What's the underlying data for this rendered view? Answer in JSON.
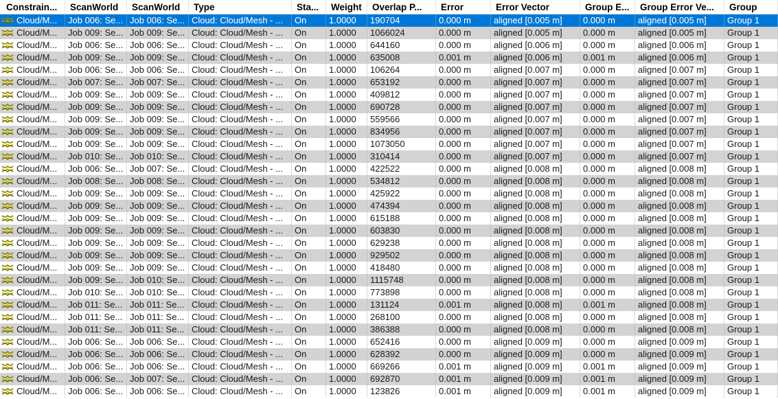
{
  "icons": {
    "constraint": "cloud-constraint-icon"
  },
  "colors": {
    "selected_row": "#0078d7",
    "alt_row": "#d3d3d3"
  },
  "columns": [
    "Constrain...",
    "ScanWorld",
    "ScanWorld",
    "Type",
    "Sta...",
    "Weight",
    "Overlap P...",
    "Error",
    "Error Vector",
    "Group E...",
    "Group Error Ve...",
    "Group"
  ],
  "rows": [
    [
      "Cloud/M...",
      "Job 006: Se...",
      "Job 006: Se...",
      "Cloud: Cloud/Mesh - ...",
      "On",
      "1.0000",
      "190704",
      "0.000 m",
      "aligned [0.005 m]",
      "0.000 m",
      "aligned [0.005 m]",
      "Group 1"
    ],
    [
      "Cloud/M...",
      "Job 009: Se...",
      "Job 009: Se...",
      "Cloud: Cloud/Mesh - ...",
      "On",
      "1.0000",
      "1066024",
      "0.000 m",
      "aligned [0.005 m]",
      "0.000 m",
      "aligned [0.005 m]",
      "Group 1"
    ],
    [
      "Cloud/M...",
      "Job 006: Se...",
      "Job 006: Se...",
      "Cloud: Cloud/Mesh - ...",
      "On",
      "1.0000",
      "644160",
      "0.000 m",
      "aligned [0.006 m]",
      "0.000 m",
      "aligned [0.006 m]",
      "Group 1"
    ],
    [
      "Cloud/M...",
      "Job 009: Se...",
      "Job 009: Se...",
      "Cloud: Cloud/Mesh - ...",
      "On",
      "1.0000",
      "635008",
      "0.001 m",
      "aligned [0.006 m]",
      "0.001 m",
      "aligned [0.006 m]",
      "Group 1"
    ],
    [
      "Cloud/M...",
      "Job 006: Se...",
      "Job 006: Se...",
      "Cloud: Cloud/Mesh - ...",
      "On",
      "1.0000",
      "106264",
      "0.000 m",
      "aligned [0.007 m]",
      "0.000 m",
      "aligned [0.007 m]",
      "Group 1"
    ],
    [
      "Cloud/M...",
      "Job 007: Se...",
      "Job 007: Se...",
      "Cloud: Cloud/Mesh - ...",
      "On",
      "1.0000",
      "653192",
      "0.000 m",
      "aligned [0.007 m]",
      "0.000 m",
      "aligned [0.007 m]",
      "Group 1"
    ],
    [
      "Cloud/M...",
      "Job 009: Se...",
      "Job 009: Se...",
      "Cloud: Cloud/Mesh - ...",
      "On",
      "1.0000",
      "409812",
      "0.000 m",
      "aligned [0.007 m]",
      "0.000 m",
      "aligned [0.007 m]",
      "Group 1"
    ],
    [
      "Cloud/M...",
      "Job 009: Se...",
      "Job 009: Se...",
      "Cloud: Cloud/Mesh - ...",
      "On",
      "1.0000",
      "690728",
      "0.000 m",
      "aligned [0.007 m]",
      "0.000 m",
      "aligned [0.007 m]",
      "Group 1"
    ],
    [
      "Cloud/M...",
      "Job 009: Se...",
      "Job 009: Se...",
      "Cloud: Cloud/Mesh - ...",
      "On",
      "1.0000",
      "559566",
      "0.000 m",
      "aligned [0.007 m]",
      "0.000 m",
      "aligned [0.007 m]",
      "Group 1"
    ],
    [
      "Cloud/M...",
      "Job 009: Se...",
      "Job 009: Se...",
      "Cloud: Cloud/Mesh - ...",
      "On",
      "1.0000",
      "834956",
      "0.000 m",
      "aligned [0.007 m]",
      "0.000 m",
      "aligned [0.007 m]",
      "Group 1"
    ],
    [
      "Cloud/M...",
      "Job 009: Se...",
      "Job 009: Se...",
      "Cloud: Cloud/Mesh - ...",
      "On",
      "1.0000",
      "1073050",
      "0.000 m",
      "aligned [0.007 m]",
      "0.000 m",
      "aligned [0.007 m]",
      "Group 1"
    ],
    [
      "Cloud/M...",
      "Job 010: Se...",
      "Job 010: Se...",
      "Cloud: Cloud/Mesh - ...",
      "On",
      "1.0000",
      "310414",
      "0.000 m",
      "aligned [0.007 m]",
      "0.000 m",
      "aligned [0.007 m]",
      "Group 1"
    ],
    [
      "Cloud/M...",
      "Job 006: Se...",
      "Job 007: Se...",
      "Cloud: Cloud/Mesh - ...",
      "On",
      "1.0000",
      "422522",
      "0.000 m",
      "aligned [0.008 m]",
      "0.000 m",
      "aligned [0.008 m]",
      "Group 1"
    ],
    [
      "Cloud/M...",
      "Job 008: Se...",
      "Job 008: Se...",
      "Cloud: Cloud/Mesh - ...",
      "On",
      "1.0000",
      "534812",
      "0.000 m",
      "aligned [0.008 m]",
      "0.000 m",
      "aligned [0.008 m]",
      "Group 1"
    ],
    [
      "Cloud/M...",
      "Job 009: Se...",
      "Job 009: Se...",
      "Cloud: Cloud/Mesh - ...",
      "On",
      "1.0000",
      "425922",
      "0.000 m",
      "aligned [0.008 m]",
      "0.000 m",
      "aligned [0.008 m]",
      "Group 1"
    ],
    [
      "Cloud/M...",
      "Job 009: Se...",
      "Job 009: Se...",
      "Cloud: Cloud/Mesh - ...",
      "On",
      "1.0000",
      "474394",
      "0.000 m",
      "aligned [0.008 m]",
      "0.000 m",
      "aligned [0.008 m]",
      "Group 1"
    ],
    [
      "Cloud/M...",
      "Job 009: Se...",
      "Job 009: Se...",
      "Cloud: Cloud/Mesh - ...",
      "On",
      "1.0000",
      "615188",
      "0.000 m",
      "aligned [0.008 m]",
      "0.000 m",
      "aligned [0.008 m]",
      "Group 1"
    ],
    [
      "Cloud/M...",
      "Job 009: Se...",
      "Job 009: Se...",
      "Cloud: Cloud/Mesh - ...",
      "On",
      "1.0000",
      "603830",
      "0.000 m",
      "aligned [0.008 m]",
      "0.000 m",
      "aligned [0.008 m]",
      "Group 1"
    ],
    [
      "Cloud/M...",
      "Job 009: Se...",
      "Job 009: Se...",
      "Cloud: Cloud/Mesh - ...",
      "On",
      "1.0000",
      "629238",
      "0.000 m",
      "aligned [0.008 m]",
      "0.000 m",
      "aligned [0.008 m]",
      "Group 1"
    ],
    [
      "Cloud/M...",
      "Job 009: Se...",
      "Job 009: Se...",
      "Cloud: Cloud/Mesh - ...",
      "On",
      "1.0000",
      "929502",
      "0.000 m",
      "aligned [0.008 m]",
      "0.000 m",
      "aligned [0.008 m]",
      "Group 1"
    ],
    [
      "Cloud/M...",
      "Job 009: Se...",
      "Job 009: Se...",
      "Cloud: Cloud/Mesh - ...",
      "On",
      "1.0000",
      "418480",
      "0.000 m",
      "aligned [0.008 m]",
      "0.000 m",
      "aligned [0.008 m]",
      "Group 1"
    ],
    [
      "Cloud/M...",
      "Job 009: Se...",
      "Job 010: Se...",
      "Cloud: Cloud/Mesh - ...",
      "On",
      "1.0000",
      "1115748",
      "0.000 m",
      "aligned [0.008 m]",
      "0.000 m",
      "aligned [0.008 m]",
      "Group 1"
    ],
    [
      "Cloud/M...",
      "Job 010: Se...",
      "Job 010: Se...",
      "Cloud: Cloud/Mesh - ...",
      "On",
      "1.0000",
      "773898",
      "0.000 m",
      "aligned [0.008 m]",
      "0.000 m",
      "aligned [0.008 m]",
      "Group 1"
    ],
    [
      "Cloud/M...",
      "Job 011: Se...",
      "Job 011: Se...",
      "Cloud: Cloud/Mesh - ...",
      "On",
      "1.0000",
      "131124",
      "0.001 m",
      "aligned [0.008 m]",
      "0.001 m",
      "aligned [0.008 m]",
      "Group 1"
    ],
    [
      "Cloud/M...",
      "Job 011: Se...",
      "Job 011: Se...",
      "Cloud: Cloud/Mesh - ...",
      "On",
      "1.0000",
      "268100",
      "0.000 m",
      "aligned [0.008 m]",
      "0.000 m",
      "aligned [0.008 m]",
      "Group 1"
    ],
    [
      "Cloud/M...",
      "Job 011: Se...",
      "Job 011: Se...",
      "Cloud: Cloud/Mesh - ...",
      "On",
      "1.0000",
      "386388",
      "0.000 m",
      "aligned [0.008 m]",
      "0.000 m",
      "aligned [0.008 m]",
      "Group 1"
    ],
    [
      "Cloud/M...",
      "Job 006: Se...",
      "Job 006: Se...",
      "Cloud: Cloud/Mesh - ...",
      "On",
      "1.0000",
      "652416",
      "0.000 m",
      "aligned [0.009 m]",
      "0.000 m",
      "aligned [0.009 m]",
      "Group 1"
    ],
    [
      "Cloud/M...",
      "Job 006: Se...",
      "Job 006: Se...",
      "Cloud: Cloud/Mesh - ...",
      "On",
      "1.0000",
      "628392",
      "0.000 m",
      "aligned [0.009 m]",
      "0.000 m",
      "aligned [0.009 m]",
      "Group 1"
    ],
    [
      "Cloud/M...",
      "Job 006: Se...",
      "Job 006: Se...",
      "Cloud: Cloud/Mesh - ...",
      "On",
      "1.0000",
      "669266",
      "0.001 m",
      "aligned [0.009 m]",
      "0.001 m",
      "aligned [0.009 m]",
      "Group 1"
    ],
    [
      "Cloud/M...",
      "Job 006: Se...",
      "Job 007: Se...",
      "Cloud: Cloud/Mesh - ...",
      "On",
      "1.0000",
      "692870",
      "0.001 m",
      "aligned [0.009 m]",
      "0.001 m",
      "aligned [0.009 m]",
      "Group 1"
    ],
    [
      "Cloud/M...",
      "Job 006: Se...",
      "Job 006: Se...",
      "Cloud: Cloud/Mesh - ...",
      "On",
      "1.0000",
      "123826",
      "0.001 m",
      "aligned [0.009 m]",
      "0.001 m",
      "aligned [0.009 m]",
      "Group 1"
    ]
  ]
}
